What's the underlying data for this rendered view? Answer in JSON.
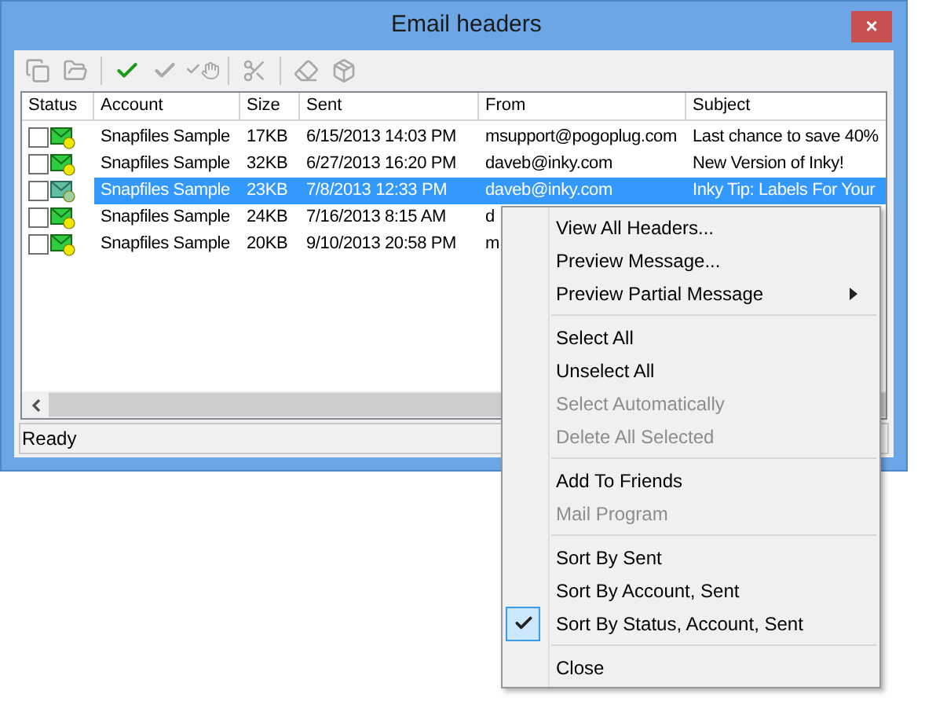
{
  "window": {
    "title": "Email headers",
    "close": "×"
  },
  "toolbar": [
    {
      "kind": "copy",
      "disabled": true
    },
    {
      "kind": "folder",
      "disabled": true
    },
    {
      "kind": "check",
      "disabled": false
    },
    {
      "kind": "check",
      "disabled": true
    },
    {
      "kind": "check-hand",
      "disabled": true
    },
    {
      "kind": "cut",
      "disabled": true
    },
    {
      "kind": "eraser",
      "disabled": true
    },
    {
      "kind": "package",
      "disabled": true
    }
  ],
  "table": {
    "columns": [
      "Status",
      "Account",
      "Size",
      "Sent",
      "From",
      "Subject"
    ],
    "rows": [
      {
        "checked": false,
        "selected": false,
        "account": "Snapfiles Sample",
        "size": "17KB",
        "sent": "6/15/2013 14:03 PM",
        "from": "msupport@pogoplug.com",
        "subject": "Last chance to save 40%"
      },
      {
        "checked": false,
        "selected": false,
        "account": "Snapfiles Sample",
        "size": "32KB",
        "sent": "6/27/2013 16:20 PM",
        "from": "daveb@inky.com",
        "subject": "New Version of Inky!"
      },
      {
        "checked": false,
        "selected": true,
        "account": "Snapfiles Sample",
        "size": "23KB",
        "sent": "7/8/2013 12:33 PM",
        "from": "daveb@inky.com",
        "subject": "Inky Tip: Labels For Your"
      },
      {
        "checked": false,
        "selected": false,
        "account": "Snapfiles Sample",
        "size": "24KB",
        "sent": "7/16/2013 8:15 AM",
        "from": "d"
      },
      {
        "checked": false,
        "selected": false,
        "account": "Snapfiles Sample",
        "size": "20KB",
        "sent": "9/10/2013 20:58 PM",
        "from": "m"
      }
    ]
  },
  "status_bar": "Ready",
  "context_menu": [
    {
      "kind": "item",
      "label": "View All Headers...",
      "disabled": false,
      "checked": false
    },
    {
      "kind": "item",
      "label": "Preview Message...",
      "disabled": false,
      "checked": false
    },
    {
      "kind": "submenu",
      "label": "Preview Partial Message",
      "disabled": false,
      "checked": false
    },
    {
      "kind": "separator"
    },
    {
      "kind": "item",
      "label": "Select All",
      "disabled": false,
      "checked": false
    },
    {
      "kind": "item",
      "label": "Unselect All",
      "disabled": false,
      "checked": false
    },
    {
      "kind": "item",
      "label": "Select Automatically",
      "disabled": true,
      "checked": false
    },
    {
      "kind": "item",
      "label": "Delete All Selected",
      "disabled": true,
      "checked": false
    },
    {
      "kind": "separator"
    },
    {
      "kind": "item",
      "label": "Add To Friends",
      "disabled": false,
      "checked": false
    },
    {
      "kind": "item",
      "label": "Mail Program",
      "disabled": true,
      "checked": false
    },
    {
      "kind": "separator"
    },
    {
      "kind": "item",
      "label": "Sort By Sent",
      "disabled": false,
      "checked": false
    },
    {
      "kind": "item",
      "label": "Sort By Account, Sent",
      "disabled": false,
      "checked": false
    },
    {
      "kind": "item",
      "label": "Sort By Status, Account, Sent",
      "disabled": false,
      "checked": true
    },
    {
      "kind": "separator"
    },
    {
      "kind": "item",
      "label": "Close",
      "disabled": false,
      "checked": false
    }
  ]
}
